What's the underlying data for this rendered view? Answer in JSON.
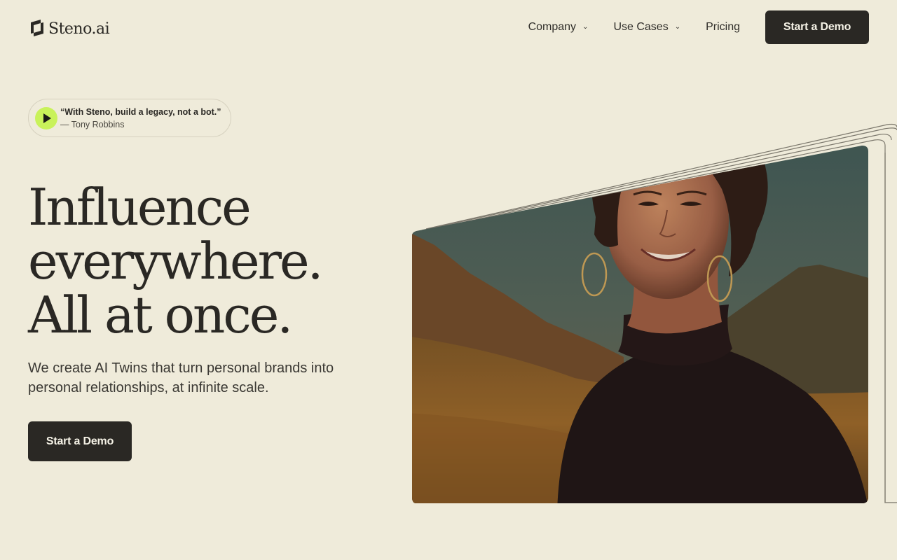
{
  "brand": {
    "name": "Steno.ai"
  },
  "nav": {
    "items": [
      {
        "label": "Company",
        "has_dropdown": true
      },
      {
        "label": "Use Cases",
        "has_dropdown": true
      },
      {
        "label": "Pricing",
        "has_dropdown": false
      }
    ],
    "cta_label": "Start a Demo"
  },
  "quote": {
    "text": "“With Steno, build a legacy, not a bot.”",
    "author": "— Tony Robbins",
    "play_icon": "play-icon"
  },
  "hero": {
    "title_lines": [
      "Influence",
      "everywhere.",
      "All at once."
    ],
    "subtitle": "We create AI Twins that turn personal brands into personal relationships, at infinite scale.",
    "cta_label": "Start a Demo"
  },
  "colors": {
    "background": "#efebda",
    "dark": "#2a2824",
    "accent_green": "#c9f25a"
  }
}
